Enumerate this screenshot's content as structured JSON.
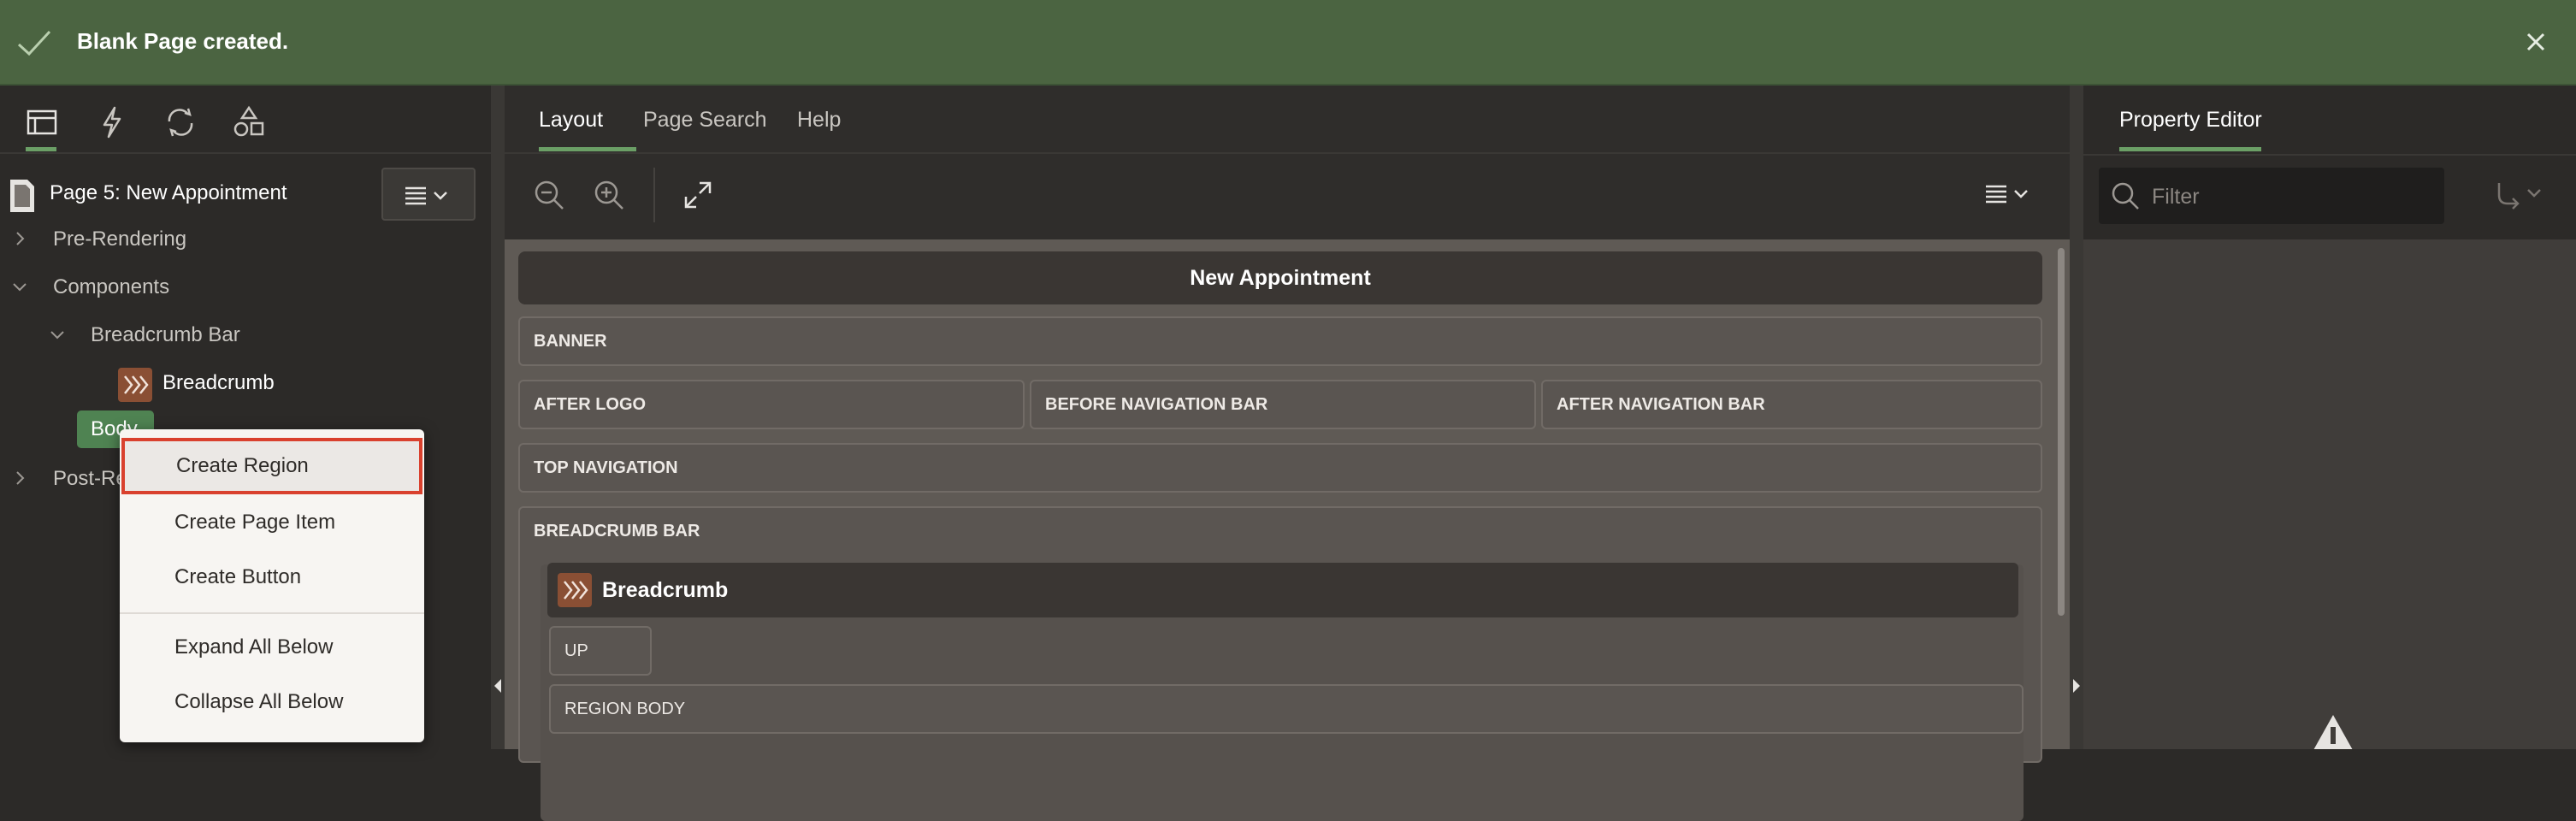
{
  "banner": {
    "message": "Blank Page created."
  },
  "left": {
    "page_title": "Page 5: New Appointment",
    "tree": {
      "pre_rendering": "Pre-Rendering",
      "components": "Components",
      "breadcrumb_bar": "Breadcrumb Bar",
      "breadcrumb": "Breadcrumb",
      "body": "Body",
      "post_rendering": "Post-Re"
    }
  },
  "context_menu": {
    "items": [
      "Create Region",
      "Create Page Item",
      "Create Button",
      "Expand All Below",
      "Collapse All Below"
    ]
  },
  "center": {
    "tabs": [
      "Layout",
      "Page Search",
      "Help"
    ],
    "canvas": {
      "title": "New Appointment",
      "banner": "BANNER",
      "after_logo": "AFTER LOGO",
      "before_nav": "BEFORE NAVIGATION BAR",
      "after_nav": "AFTER NAVIGATION BAR",
      "top_nav": "TOP NAVIGATION",
      "breadcrumb_bar": "BREADCRUMB BAR",
      "breadcrumb_region": "Breadcrumb",
      "up": "UP",
      "region_body": "REGION BODY"
    }
  },
  "right": {
    "tab": "Property Editor",
    "filter_placeholder": "Filter"
  },
  "colors": {
    "accent": "#6b9f66",
    "banner": "#4b6441",
    "highlight": "#d9412e",
    "breadcrumb_icon": "#8a4f34"
  }
}
